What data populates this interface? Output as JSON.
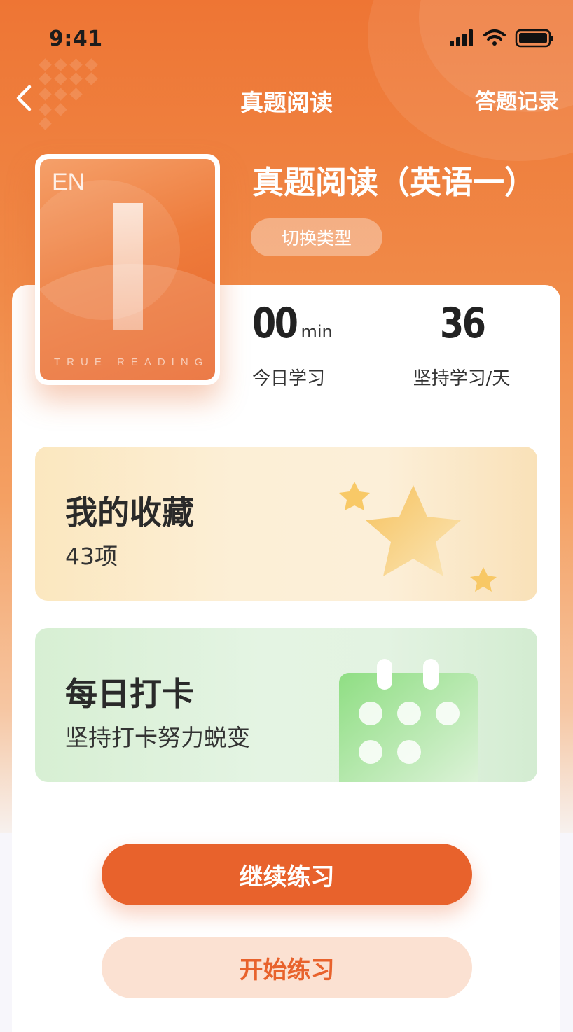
{
  "status_bar": {
    "time": "9:41",
    "icons": [
      "signal-icon",
      "wifi-icon",
      "battery-icon"
    ]
  },
  "nav": {
    "back_icon": "chevron-left-icon",
    "title": "真题阅读",
    "right_link": "答题记录"
  },
  "book": {
    "label": "EN",
    "subtitle": "TRUE READING"
  },
  "course": {
    "title": "真题阅读（英语一）",
    "switch_label": "切换类型"
  },
  "stats": {
    "today": {
      "value": "00",
      "unit": "min",
      "label": "今日学习"
    },
    "streak": {
      "value": "36",
      "label": "坚持学习/天"
    }
  },
  "favorites": {
    "title": "我的收藏",
    "count": "43项",
    "icon": "star-icon"
  },
  "checkin": {
    "title": "每日打卡",
    "subtitle": "坚持打卡努力蜕变",
    "icon": "calendar-icon"
  },
  "actions": {
    "continue_label": "继续练习",
    "start_label": "开始练习"
  },
  "colors": {
    "primary": "#e8622c",
    "header": "#ee7534",
    "favorite_bg": "#fcefd6",
    "checkin_bg": "#e3f3e2"
  }
}
